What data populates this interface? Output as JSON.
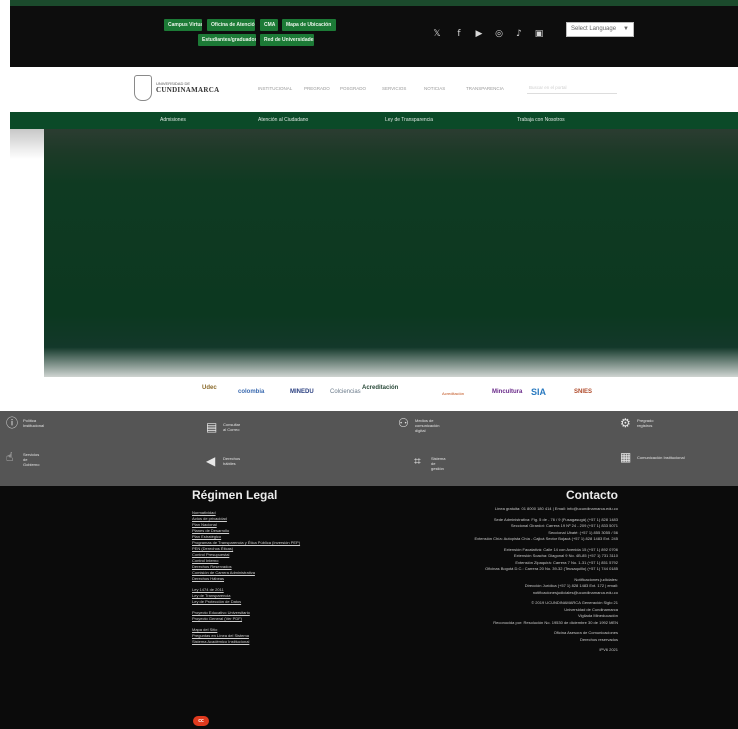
{
  "topbar": {
    "pills": [
      "Campus Virtual",
      "Oficina de Atención",
      "CMA",
      "Mapa de Ubicación",
      "Estudiantes/graduados",
      "Red de Universidades"
    ],
    "social_icons": [
      "x-icon",
      "facebook-icon",
      "youtube-icon",
      "instagram-icon",
      "tiktok-icon",
      "linkedin-icon"
    ],
    "language_select": "Select Language"
  },
  "header": {
    "logo_university": "UNIVERSIDAD DE",
    "logo_name": "CUNDINAMARCA",
    "nav": [
      "INSTITUCIONAL",
      "PREGRADO",
      "POSGRADO",
      "SERVICIOS",
      "NOTICIAS",
      "TRANSPARENCIA"
    ],
    "search_placeholder": "Buscar en el portal"
  },
  "green_nav": [
    "Admisiones",
    "Atención al Ciudadano",
    "Ley de Transparencia",
    "Trabaja con Nosotros"
  ],
  "partner_logos": [
    "Udec",
    "colombia",
    "MINEDU",
    "Colciencias",
    "Acreditación",
    "Acreditación",
    "Mincultura",
    "SIA",
    "SNIES"
  ],
  "services": [
    {
      "icon": "info-icon",
      "label": "Política\nInstitucional"
    },
    {
      "icon": "document-icon",
      "label": "Consultar\nal Correo"
    },
    {
      "icon": "graduate-icon",
      "label": "Medios de\ncomunicación\ndigital"
    },
    {
      "icon": "gear-icon",
      "label": "Pregrado\nregistros"
    },
    {
      "icon": "hand-icon",
      "label": "Servicios\nde\nGobierno"
    },
    {
      "icon": "megaphone-icon",
      "label": "Derechos\nhábiles"
    },
    {
      "icon": "map-icon",
      "label": "Sistema\nde\ngestión"
    },
    {
      "icon": "calendar-icon",
      "label": "Comunicación Institucional"
    }
  ],
  "footer": {
    "legal_title": "Régimen Legal",
    "legal_links": [
      "Normatividad",
      "Actos de privacidad",
      "Plan Nacional",
      "Planes de Desarrollo",
      "Plan Estratégico",
      "Programas de Transparencia y Ética Pública (Inversión PEP)",
      "PEN (Derechos Éticas)",
      "Control Presupuestal",
      "Control Interno",
      "Derechos Reservados",
      "Comisión de Carrera Administrativa",
      "Derechos Hábeas",
      "Ley 1474 de 2011",
      "Ley de Transparencia",
      "Ley de Protección de Datos",
      "Proyecto Educativo Universitario",
      "Proyecto General (Ver PDF)",
      "Mapa del Sitio",
      "Preguntas en Línea del Sistema",
      "Sistema Académico Institucional"
    ],
    "contact_title": "Contacto",
    "contact_lines": [
      "Línea gratuita: 01 8000 180 414 | Email: info@ucundinamarca.edu.co",
      "",
      "Sede Administrativa: Fig. 5 de - 76 / 9 (Fusagasugá) (+57 1) 828 1483",
      "Seccional Girardot: Carrera 19 Nº 24 - 209 (+57 1) 833 5071",
      "Seccional Ubaté: (+57 1) 855 3055 / 56",
      "Extensión Chía: Autopista Chía - Cajicá Sector Bojacá (+57 1) 828 1483 Ext. 245",
      "",
      "Extensión Facatativá: Calle 14 con Avenida 15 (+57 1) 892 0706",
      "Extensión Soacha: Diagonal 9 No. 4B-85 (+57 1) 731 3110",
      "Extensión Zipaquirá: Carrera 7 No. 1-31 (+57 1) 851 5792",
      "Oficinas Bogotá D.C.: Carrera 20 No. 39-32 (Teusaquillo) (+57 1) 744 0185",
      "",
      "Notificaciones judiciales:",
      "Dirección Jurídica (+57 1) 828 1483 Ext. 172 | email:",
      "notificacionesjudiciales@ucundinamarca.edu.co",
      "",
      "© 2019 UCUNDINAMARCA Generación Siglo 21",
      "Universidad de Cundinamarca",
      "Vigilada Mineducación",
      "Reconocida por: Resolución No. 19530 de diciembre 30 de 1992 MEN",
      "",
      "Oficina Asesora de Comunicaciones",
      "Derechos reservados",
      "",
      "IPV6 2021"
    ],
    "license_badge": "cc"
  },
  "colors": {
    "accent_green": "#1c7a36",
    "nav_green": "#0b4a28",
    "footer_black": "#0b0b0b",
    "band_grey": "#555555"
  }
}
